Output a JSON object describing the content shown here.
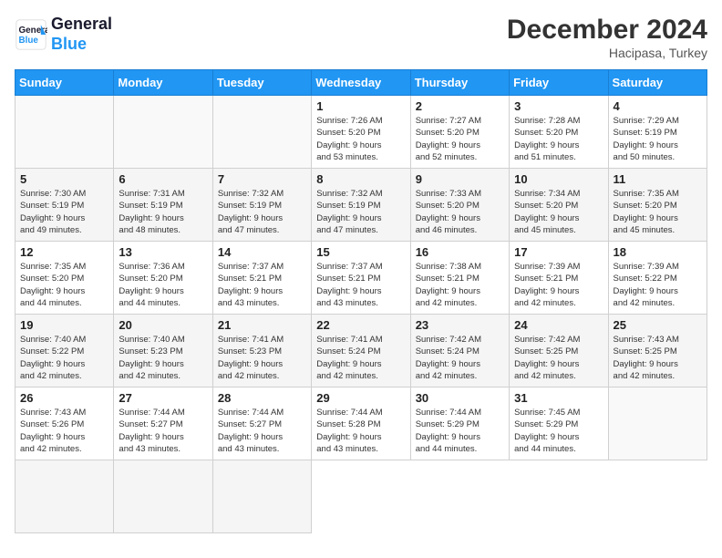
{
  "header": {
    "logo_line1": "General",
    "logo_line2": "Blue",
    "month_title": "December 2024",
    "location": "Hacipasa, Turkey"
  },
  "weekdays": [
    "Sunday",
    "Monday",
    "Tuesday",
    "Wednesday",
    "Thursday",
    "Friday",
    "Saturday"
  ],
  "days": [
    {
      "num": "",
      "info": ""
    },
    {
      "num": "",
      "info": ""
    },
    {
      "num": "",
      "info": ""
    },
    {
      "num": "1",
      "info": "Sunrise: 7:26 AM\nSunset: 5:20 PM\nDaylight: 9 hours\nand 53 minutes."
    },
    {
      "num": "2",
      "info": "Sunrise: 7:27 AM\nSunset: 5:20 PM\nDaylight: 9 hours\nand 52 minutes."
    },
    {
      "num": "3",
      "info": "Sunrise: 7:28 AM\nSunset: 5:20 PM\nDaylight: 9 hours\nand 51 minutes."
    },
    {
      "num": "4",
      "info": "Sunrise: 7:29 AM\nSunset: 5:19 PM\nDaylight: 9 hours\nand 50 minutes."
    },
    {
      "num": "5",
      "info": "Sunrise: 7:30 AM\nSunset: 5:19 PM\nDaylight: 9 hours\nand 49 minutes."
    },
    {
      "num": "6",
      "info": "Sunrise: 7:31 AM\nSunset: 5:19 PM\nDaylight: 9 hours\nand 48 minutes."
    },
    {
      "num": "7",
      "info": "Sunrise: 7:32 AM\nSunset: 5:19 PM\nDaylight: 9 hours\nand 47 minutes."
    },
    {
      "num": "8",
      "info": "Sunrise: 7:32 AM\nSunset: 5:19 PM\nDaylight: 9 hours\nand 47 minutes."
    },
    {
      "num": "9",
      "info": "Sunrise: 7:33 AM\nSunset: 5:20 PM\nDaylight: 9 hours\nand 46 minutes."
    },
    {
      "num": "10",
      "info": "Sunrise: 7:34 AM\nSunset: 5:20 PM\nDaylight: 9 hours\nand 45 minutes."
    },
    {
      "num": "11",
      "info": "Sunrise: 7:35 AM\nSunset: 5:20 PM\nDaylight: 9 hours\nand 45 minutes."
    },
    {
      "num": "12",
      "info": "Sunrise: 7:35 AM\nSunset: 5:20 PM\nDaylight: 9 hours\nand 44 minutes."
    },
    {
      "num": "13",
      "info": "Sunrise: 7:36 AM\nSunset: 5:20 PM\nDaylight: 9 hours\nand 44 minutes."
    },
    {
      "num": "14",
      "info": "Sunrise: 7:37 AM\nSunset: 5:21 PM\nDaylight: 9 hours\nand 43 minutes."
    },
    {
      "num": "15",
      "info": "Sunrise: 7:37 AM\nSunset: 5:21 PM\nDaylight: 9 hours\nand 43 minutes."
    },
    {
      "num": "16",
      "info": "Sunrise: 7:38 AM\nSunset: 5:21 PM\nDaylight: 9 hours\nand 42 minutes."
    },
    {
      "num": "17",
      "info": "Sunrise: 7:39 AM\nSunset: 5:21 PM\nDaylight: 9 hours\nand 42 minutes."
    },
    {
      "num": "18",
      "info": "Sunrise: 7:39 AM\nSunset: 5:22 PM\nDaylight: 9 hours\nand 42 minutes."
    },
    {
      "num": "19",
      "info": "Sunrise: 7:40 AM\nSunset: 5:22 PM\nDaylight: 9 hours\nand 42 minutes."
    },
    {
      "num": "20",
      "info": "Sunrise: 7:40 AM\nSunset: 5:23 PM\nDaylight: 9 hours\nand 42 minutes."
    },
    {
      "num": "21",
      "info": "Sunrise: 7:41 AM\nSunset: 5:23 PM\nDaylight: 9 hours\nand 42 minutes."
    },
    {
      "num": "22",
      "info": "Sunrise: 7:41 AM\nSunset: 5:24 PM\nDaylight: 9 hours\nand 42 minutes."
    },
    {
      "num": "23",
      "info": "Sunrise: 7:42 AM\nSunset: 5:24 PM\nDaylight: 9 hours\nand 42 minutes."
    },
    {
      "num": "24",
      "info": "Sunrise: 7:42 AM\nSunset: 5:25 PM\nDaylight: 9 hours\nand 42 minutes."
    },
    {
      "num": "25",
      "info": "Sunrise: 7:43 AM\nSunset: 5:25 PM\nDaylight: 9 hours\nand 42 minutes."
    },
    {
      "num": "26",
      "info": "Sunrise: 7:43 AM\nSunset: 5:26 PM\nDaylight: 9 hours\nand 42 minutes."
    },
    {
      "num": "27",
      "info": "Sunrise: 7:44 AM\nSunset: 5:27 PM\nDaylight: 9 hours\nand 43 minutes."
    },
    {
      "num": "28",
      "info": "Sunrise: 7:44 AM\nSunset: 5:27 PM\nDaylight: 9 hours\nand 43 minutes."
    },
    {
      "num": "29",
      "info": "Sunrise: 7:44 AM\nSunset: 5:28 PM\nDaylight: 9 hours\nand 43 minutes."
    },
    {
      "num": "30",
      "info": "Sunrise: 7:44 AM\nSunset: 5:29 PM\nDaylight: 9 hours\nand 44 minutes."
    },
    {
      "num": "31",
      "info": "Sunrise: 7:45 AM\nSunset: 5:29 PM\nDaylight: 9 hours\nand 44 minutes."
    },
    {
      "num": "",
      "info": ""
    },
    {
      "num": "",
      "info": ""
    },
    {
      "num": "",
      "info": ""
    },
    {
      "num": "",
      "info": ""
    }
  ]
}
